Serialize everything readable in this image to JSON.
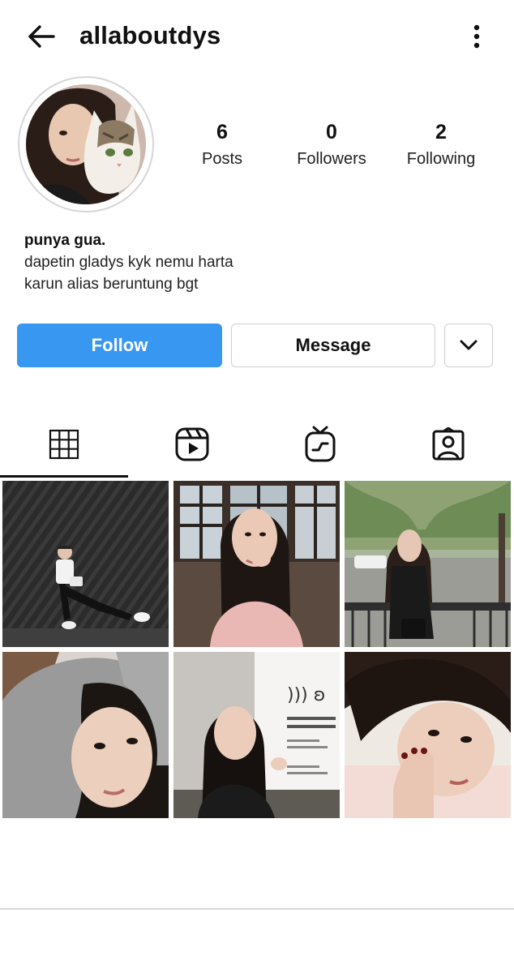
{
  "header": {
    "username": "allaboutdys"
  },
  "stats": [
    {
      "value": "6",
      "label": "Posts"
    },
    {
      "value": "0",
      "label": "Followers"
    },
    {
      "value": "2",
      "label": "Following"
    }
  ],
  "bio": {
    "name": "punya gua.",
    "lines": [
      "dapetin gladys kyk nemu harta",
      "karun alias beruntung bgt"
    ]
  },
  "actions": {
    "follow_label": "Follow",
    "message_label": "Message"
  },
  "tabs": [
    {
      "icon": "grid-icon",
      "selected": true
    },
    {
      "icon": "reels-icon",
      "selected": false
    },
    {
      "icon": "igtv-icon",
      "selected": false
    },
    {
      "icon": "tagged-icon",
      "selected": false
    }
  ],
  "colors": {
    "follow_button": "#3897f0",
    "accent_text": "#ffffff"
  },
  "posts": [
    {
      "name": "post-thumbnail-1",
      "scene": "black-wall-standing"
    },
    {
      "name": "post-thumbnail-2",
      "scene": "cafe-window-selfie"
    },
    {
      "name": "post-thumbnail-3",
      "scene": "tree-lined-street"
    },
    {
      "name": "post-thumbnail-4",
      "scene": "gray-hoodie-closeup"
    },
    {
      "name": "post-thumbnail-5",
      "scene": "museum-sign-pose"
    },
    {
      "name": "post-thumbnail-6",
      "scene": "lying-closeup-red-nails"
    }
  ]
}
